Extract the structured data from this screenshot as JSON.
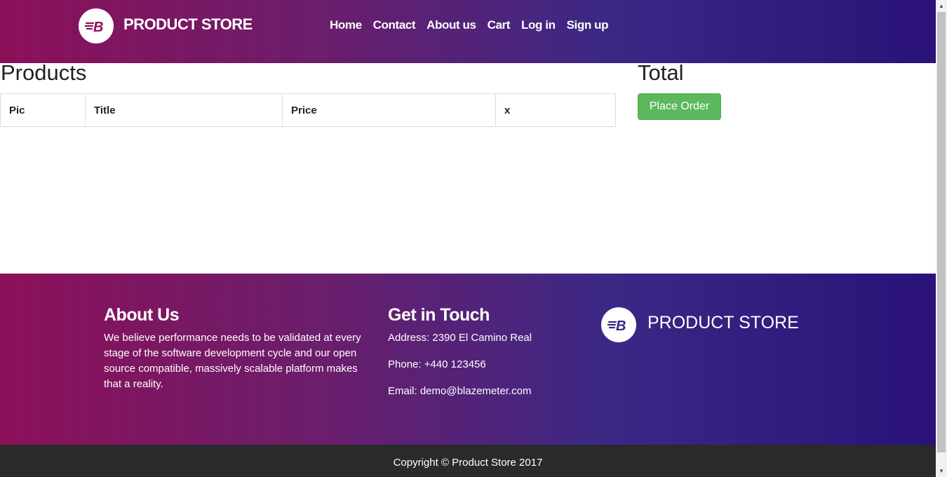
{
  "navbar": {
    "brand": "PRODUCT STORE",
    "logo_icon": "blazemeter-logo-icon",
    "links": [
      "Home",
      "Contact",
      "About us",
      "Cart",
      "Log in",
      "Sign up"
    ]
  },
  "cart": {
    "title": "Products",
    "columns": [
      "Pic",
      "Title",
      "Price",
      "x"
    ],
    "rows": []
  },
  "total": {
    "title": "Total",
    "place_order_label": "Place Order"
  },
  "footer": {
    "about_title": "About Us",
    "about_text": "We believe performance needs to be validated at every stage of the software development cycle and our open source compatible, massively scalable platform makes that a reality.",
    "touch_title": "Get in Touch",
    "address": "Address: 2390 El Camino Real",
    "phone": "Phone: +440 123456",
    "email": "Email: demo@blazemeter.com",
    "brand": "PRODUCT STORE"
  },
  "copyright": "Copyright © Product Store 2017",
  "colors": {
    "gradient_start": "#8c1059",
    "gradient_end": "#2a1278",
    "button_green": "#5cb85c",
    "copyright_bg": "#282a2c"
  }
}
